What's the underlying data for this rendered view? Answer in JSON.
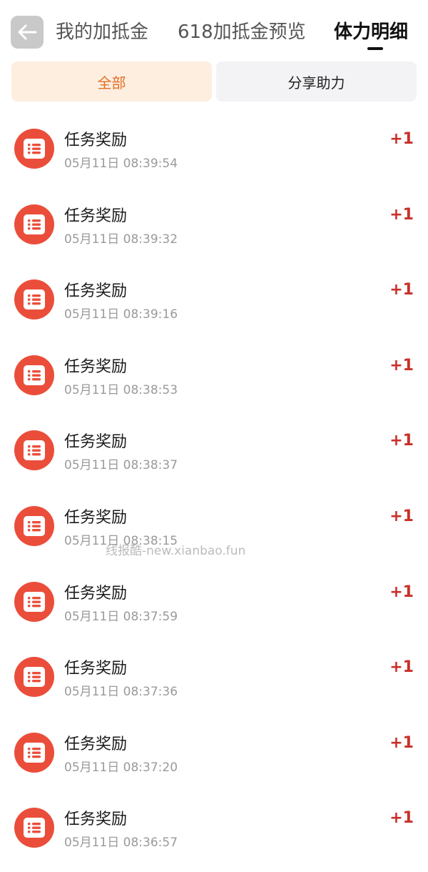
{
  "header": {
    "tabs": [
      {
        "label": "我的加抵金"
      },
      {
        "label": "618加抵金预览"
      },
      {
        "label": "体力明细"
      }
    ],
    "active_tab": "体力明细"
  },
  "filters": {
    "all_label": "全部",
    "share_label": "分享助力",
    "selected": "全部"
  },
  "records": [
    {
      "title": "任务奖励",
      "time": "05月11日 08:39:54",
      "amount": "+1"
    },
    {
      "title": "任务奖励",
      "time": "05月11日 08:39:32",
      "amount": "+1"
    },
    {
      "title": "任务奖励",
      "time": "05月11日 08:39:16",
      "amount": "+1"
    },
    {
      "title": "任务奖励",
      "time": "05月11日 08:38:53",
      "amount": "+1"
    },
    {
      "title": "任务奖励",
      "time": "05月11日 08:38:37",
      "amount": "+1"
    },
    {
      "title": "任务奖励",
      "time": "05月11日 08:38:15",
      "amount": "+1"
    },
    {
      "title": "任务奖励",
      "time": "05月11日 08:37:59",
      "amount": "+1"
    },
    {
      "title": "任务奖励",
      "time": "05月11日 08:37:36",
      "amount": "+1"
    },
    {
      "title": "任务奖励",
      "time": "05月11日 08:37:20",
      "amount": "+1"
    },
    {
      "title": "任务奖励",
      "time": "05月11日 08:36:57",
      "amount": "+1"
    }
  ],
  "watermark": "线报酷-new.xianbao.fun",
  "icons": {
    "back": "arrow-left-icon",
    "record": "list-icon"
  },
  "colors": {
    "accent_orange": "#e36f25",
    "accent_orange_bg": "#fdeee0",
    "amount_red": "#c8302a",
    "icon_red": "#ea4e3b"
  }
}
